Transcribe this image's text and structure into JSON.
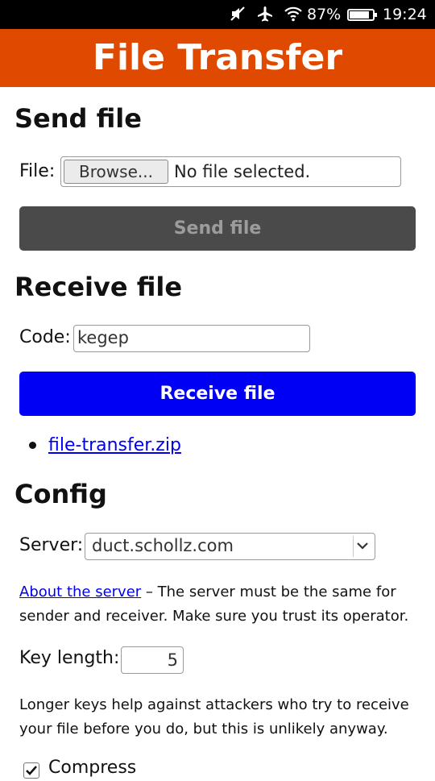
{
  "status_bar": {
    "icons": [
      "mute-icon",
      "airplane-icon",
      "wifi-icon"
    ],
    "battery_percent_text": "87%",
    "battery_level": 0.87,
    "time": "19:24"
  },
  "app": {
    "title": "File Transfer",
    "accent_color": "#e04a00"
  },
  "send": {
    "heading": "Send file",
    "file_label": "File:",
    "browse_label": "Browse...",
    "no_file_text": "No file selected.",
    "send_button_label": "Send file"
  },
  "receive": {
    "heading": "Receive file",
    "code_label": "Code:",
    "code_value": "kegep",
    "receive_button_label": "Receive file",
    "files": [
      "file-transfer.zip"
    ],
    "button_color": "#0000f5"
  },
  "config": {
    "heading": "Config",
    "server_label": "Server:",
    "server_value": "duct.schollz.com",
    "about_link": "About the server",
    "about_text": " – The server must be the same for sender and receiver. Make sure you trust its operator.",
    "key_length_label": "Key length:",
    "key_length_value": "5",
    "key_note": "Longer keys help against attackers who try to receive your file before you do, but this is unlikely anyway.",
    "compress_label": "Compress",
    "compress_checked": true
  }
}
